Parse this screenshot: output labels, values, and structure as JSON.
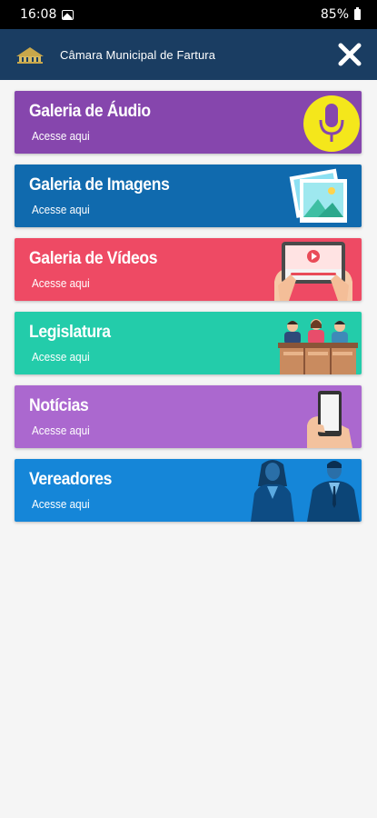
{
  "status_bar": {
    "time": "16:08",
    "battery": "85%"
  },
  "header": {
    "title": "Câmara Municipal de Fartura"
  },
  "menu": {
    "items": [
      {
        "title": "Galeria de Áudio",
        "subtitle": "Acesse aqui",
        "color": "#8646ad",
        "icon": "microphone-icon"
      },
      {
        "title": "Galeria de Imagens",
        "subtitle": "Acesse aqui",
        "color": "#106aae",
        "icon": "image-gallery-icon"
      },
      {
        "title": "Galeria de Vídeos",
        "subtitle": "Acesse aqui",
        "color": "#ee4a64",
        "icon": "video-tablet-icon"
      },
      {
        "title": "Legislatura",
        "subtitle": "Acesse aqui",
        "color": "#23ccaa",
        "icon": "legislators-icon"
      },
      {
        "title": "Notícias",
        "subtitle": "Acesse aqui",
        "color": "#ab68cf",
        "icon": "smartphone-news-icon"
      },
      {
        "title": "Vereadores",
        "subtitle": "Acesse aqui",
        "color": "#1586d8",
        "icon": "councillors-photo-icon"
      }
    ]
  },
  "colors": {
    "header_bg": "#1a3d62",
    "background": "#f5f5f5"
  }
}
